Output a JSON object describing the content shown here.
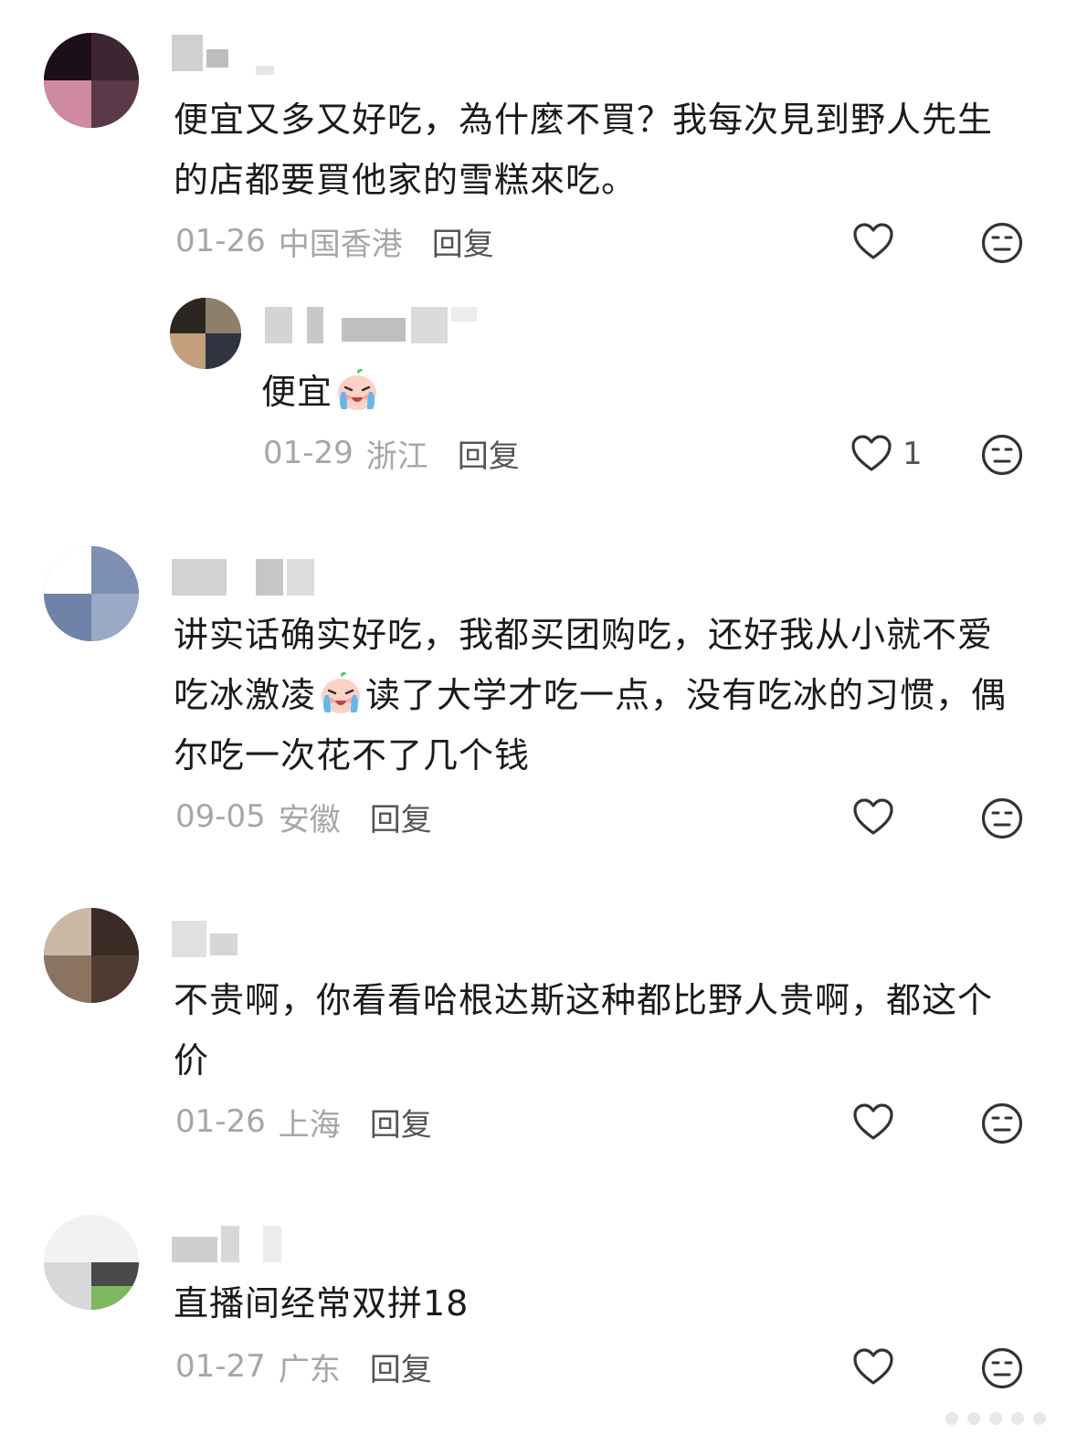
{
  "comments": [
    {
      "text": "便宜又多又好吃，為什麼不買？我每次見到野人先生的店都要買他家的雪糕來吃。",
      "date": "01-26",
      "location": "中国香港",
      "reply_label": "回复",
      "like_count": "",
      "replies": [
        {
          "text": "便宜",
          "date": "01-29",
          "location": "浙江",
          "reply_label": "回复",
          "like_count": "1"
        }
      ]
    },
    {
      "text_before_emoji": "讲实话确实好吃，我都买团购吃，还好我从小就不爱吃冰激凌",
      "text_after_emoji": "读了大学才吃一点，没有吃冰的习惯，偶尔吃一次花不了几个钱",
      "date": "09-05",
      "location": "安徽",
      "reply_label": "回复",
      "like_count": ""
    },
    {
      "text": "不贵啊，你看看哈根达斯这种都比野人贵啊，都这个价",
      "date": "01-26",
      "location": "上海",
      "reply_label": "回复",
      "like_count": ""
    },
    {
      "text": "直播间经常双拼18",
      "date": "01-27",
      "location": "广东",
      "reply_label": "回复",
      "like_count": ""
    }
  ],
  "icons": {
    "like": "heart-outline-icon",
    "dislike": "neutral-face-icon",
    "emoji": "crying-baby-emoji"
  },
  "colors": {
    "text": "#1a1a1a",
    "meta": "#a6a6a6",
    "reply": "#555555",
    "icon": "#333333"
  }
}
